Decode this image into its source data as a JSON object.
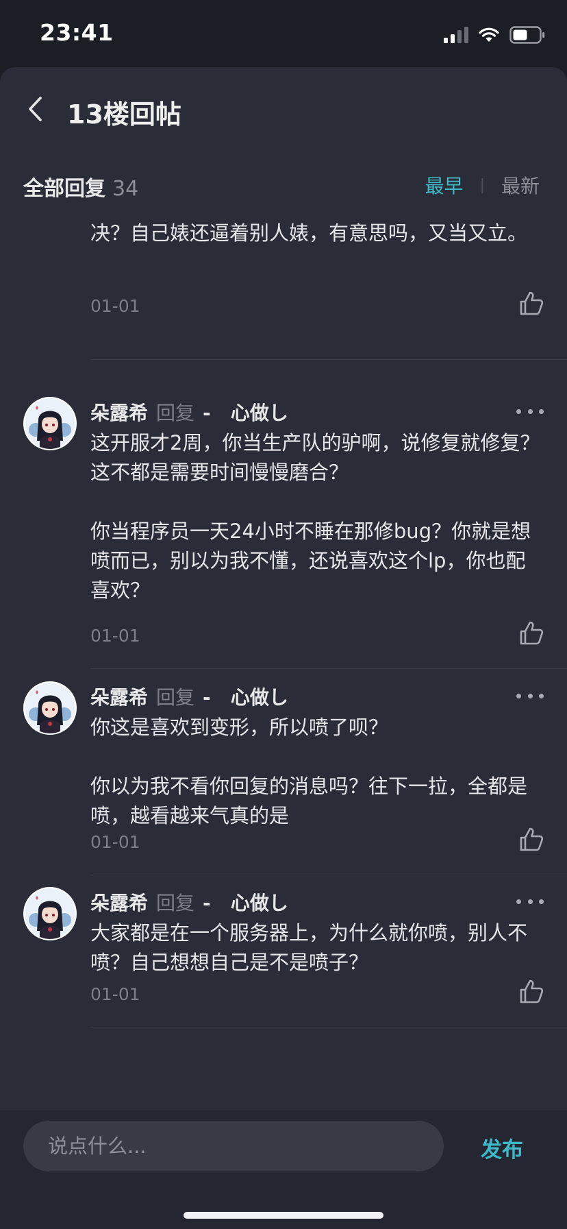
{
  "status_bar": {
    "time": "23:41",
    "icons": [
      "cellular-signal-icon",
      "wifi-icon",
      "battery-icon"
    ]
  },
  "header": {
    "back_icon": "chevron-left-icon",
    "title": "13楼回帖"
  },
  "section": {
    "title": "全部回复",
    "count": "34",
    "sort_earliest": "最早",
    "sort_newest": "最新",
    "active_sort": "最早"
  },
  "replies": [
    {
      "paragraphs": [
        "不是游戏自身的问题？是不是反馈了也没得到解决？自己婊还逼着别人婊，有意思吗，又当又立。"
      ],
      "date": "01-01"
    },
    {
      "author": "朵露希",
      "reply_word": "回复",
      "target": "-   心做し",
      "paragraphs": [
        "这开服才2周，你当生产队的驴啊，说修复就修复？这不都是需要时间慢慢磨合？",
        "你当程序员一天24小时不睡在那修bug？你就是想喷而已，别以为我不懂，还说喜欢这个lp，你也配喜欢？"
      ],
      "date": "01-01"
    },
    {
      "author": "朵露希",
      "reply_word": "回复",
      "target": "-   心做し",
      "paragraphs": [
        "你这是喜欢到变形，所以喷了呗？",
        "你以为我不看你回复的消息吗？往下一拉，全都是喷，越看越来气真的是"
      ],
      "date": "01-01"
    },
    {
      "author": "朵露希",
      "reply_word": "回复",
      "target": "-   心做し",
      "paragraphs": [
        "大家都是在一个服务器上，为什么就你喷，别人不喷？自己想想自己是不是喷子？"
      ],
      "date": "01-01"
    }
  ],
  "composer": {
    "placeholder": "说点什么...",
    "publish_label": "发布"
  },
  "colors": {
    "accent": "#3fb8c8",
    "background": "#2a2d38",
    "text": "#e6e6ea",
    "muted": "#7b7e87"
  }
}
